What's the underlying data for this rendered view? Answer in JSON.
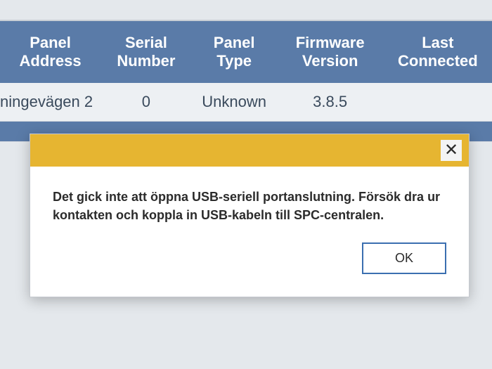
{
  "table": {
    "headers": [
      "Panel Address",
      "Serial Number",
      "Panel Type",
      "Firmware Version",
      "Last Connected"
    ],
    "rows": [
      {
        "address": "ningevägen 2",
        "serial": "0",
        "type": "Unknown",
        "firmware": "3.8.5",
        "last": ""
      }
    ]
  },
  "dialog": {
    "message": "Det gick inte att öppna USB-seriell portanslutning. Försök dra ur kontakten och koppla in USB-kabeln till SPC-centralen.",
    "ok_label": "OK",
    "close_label": "✕"
  }
}
